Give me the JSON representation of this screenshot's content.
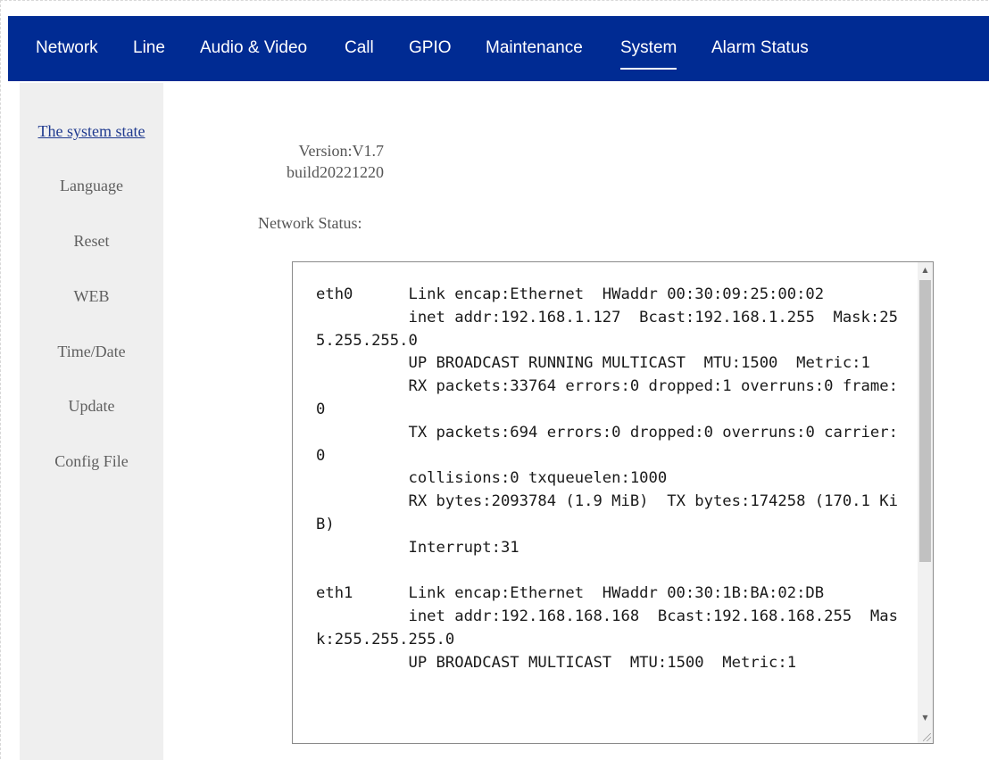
{
  "nav": {
    "items": [
      {
        "label": "Network"
      },
      {
        "label": "Line"
      },
      {
        "label": "Audio & Video"
      },
      {
        "label": "Call"
      },
      {
        "label": "GPIO"
      },
      {
        "label": "Maintenance"
      },
      {
        "label": "System",
        "active": true
      },
      {
        "label": "Alarm Status"
      }
    ]
  },
  "sidebar": {
    "items": [
      {
        "label": "The system state",
        "active": true
      },
      {
        "label": "Language"
      },
      {
        "label": "Reset"
      },
      {
        "label": "WEB"
      },
      {
        "label": "Time/Date"
      },
      {
        "label": "Update"
      },
      {
        "label": "Config File"
      }
    ]
  },
  "main": {
    "version_line1": "Version:V1.7",
    "version_line2": "build20221220",
    "network_status_label": "Network Status:",
    "network_status_text": "eth0      Link encap:Ethernet  HWaddr 00:30:09:25:00:02\n          inet addr:192.168.1.127  Bcast:192.168.1.255  Mask:255.255.255.0\n          UP BROADCAST RUNNING MULTICAST  MTU:1500  Metric:1\n          RX packets:33764 errors:0 dropped:1 overruns:0 frame:0\n          TX packets:694 errors:0 dropped:0 overruns:0 carrier:0\n          collisions:0 txqueuelen:1000\n          RX bytes:2093784 (1.9 MiB)  TX bytes:174258 (170.1 KiB)\n          Interrupt:31\n\neth1      Link encap:Ethernet  HWaddr 00:30:1B:BA:02:DB\n          inet addr:192.168.168.168  Bcast:192.168.168.255  Mask:255.255.255.0\n          UP BROADCAST MULTICAST  MTU:1500  Metric:1"
  },
  "colors": {
    "nav_bg": "#002b93",
    "sidebar_bg": "#efefef",
    "active_link": "#1f3a8f"
  }
}
